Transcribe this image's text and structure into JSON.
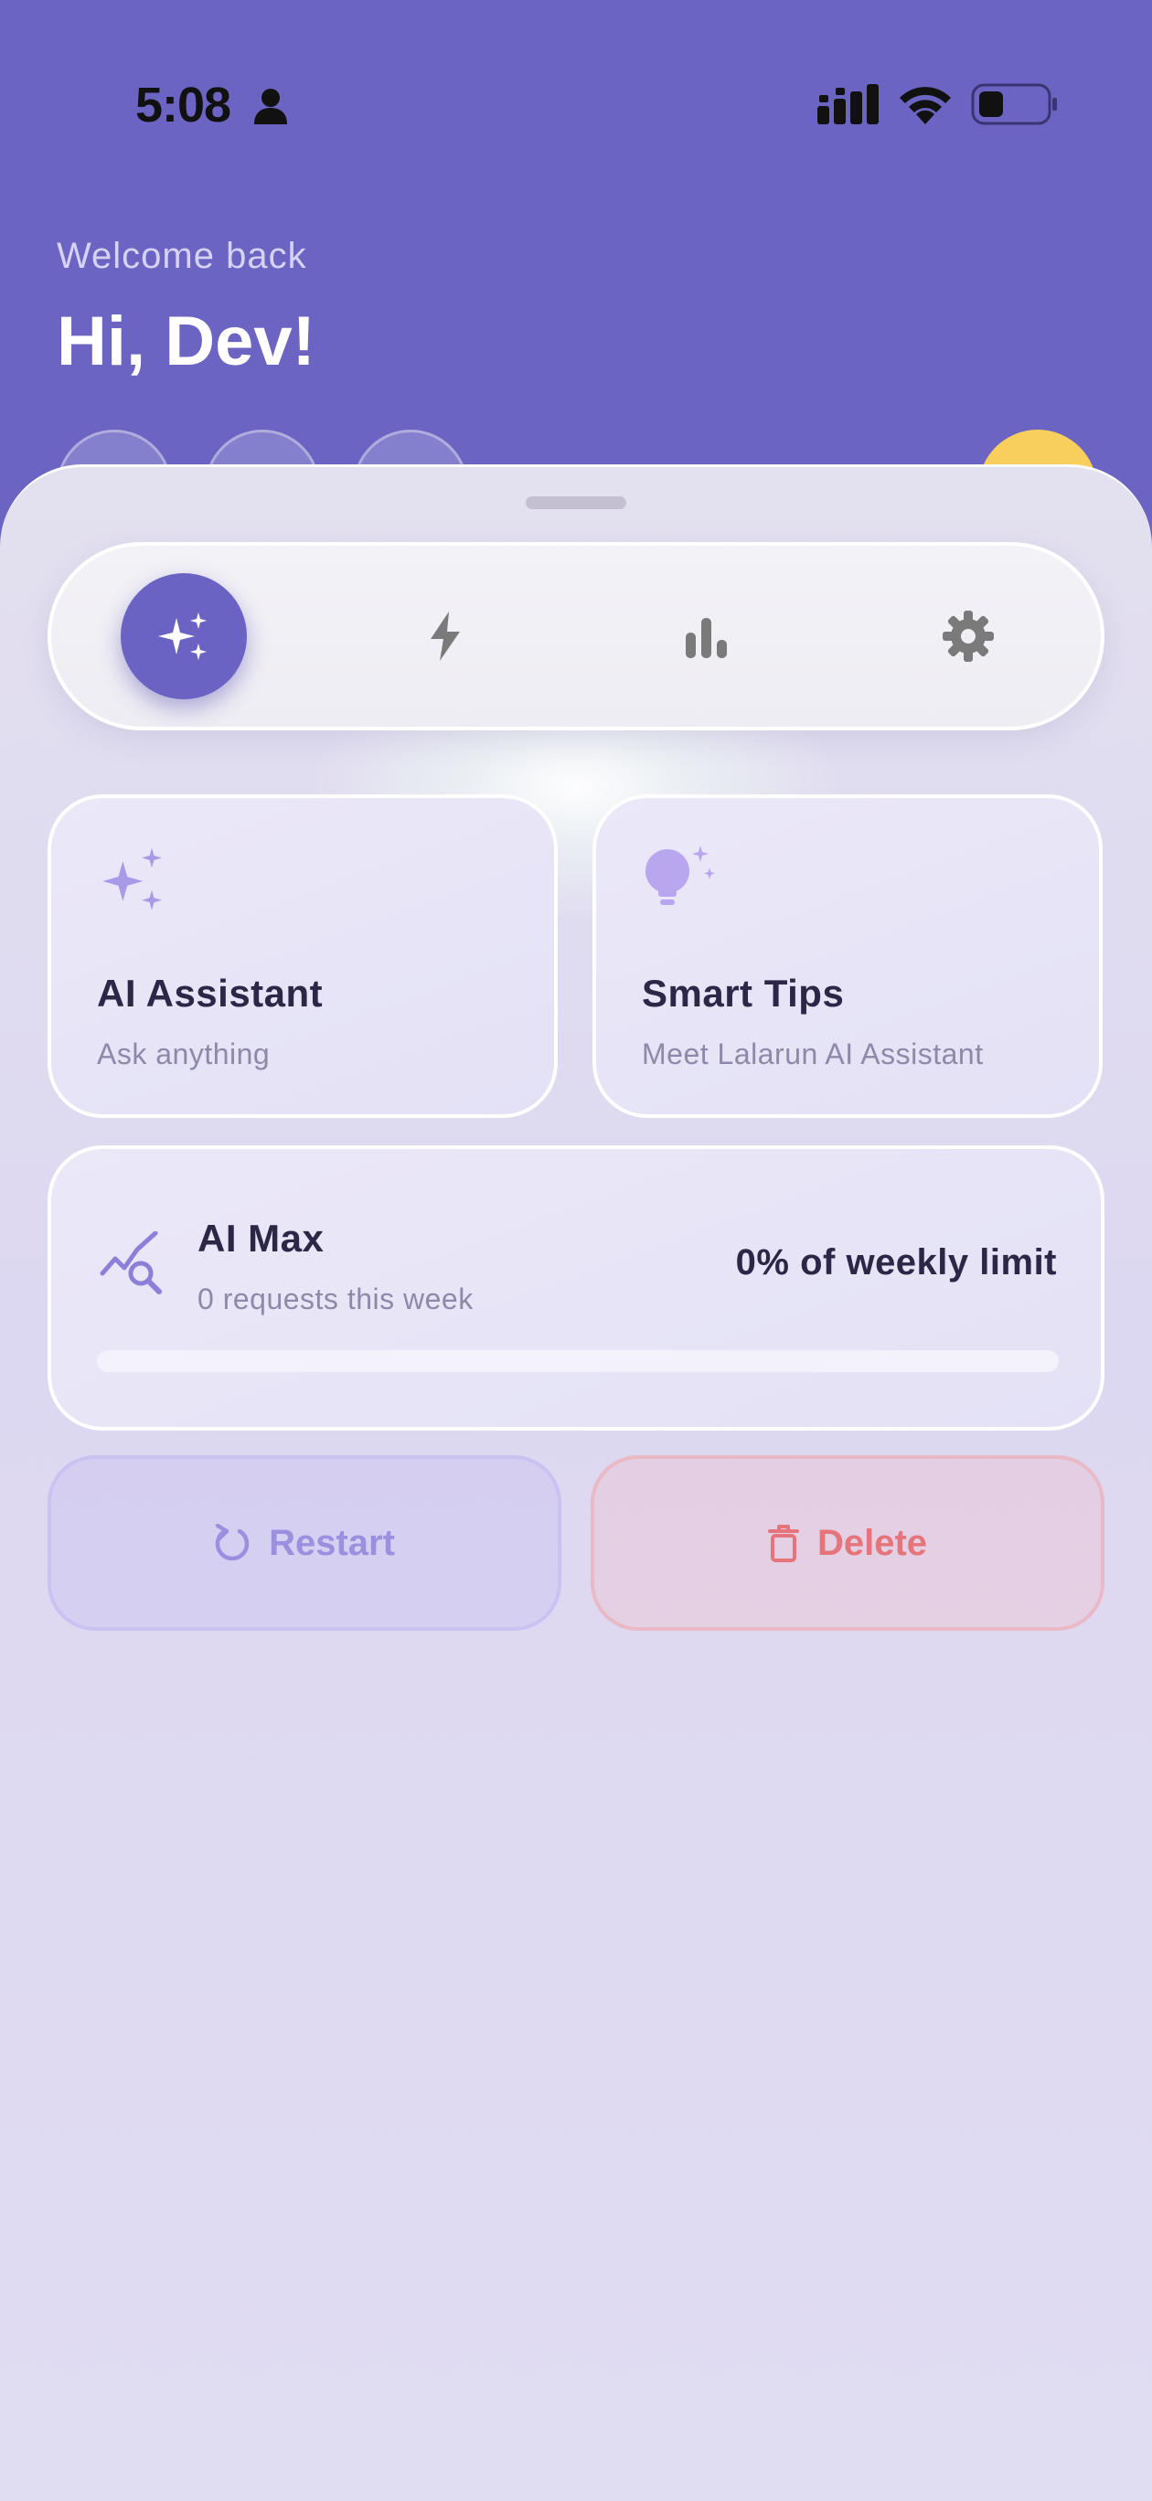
{
  "status_bar": {
    "time": "5:08"
  },
  "header": {
    "welcome": "Welcome back",
    "greeting": "Hi, Dev!"
  },
  "tabs": [
    {
      "name": "ai",
      "icon": "sparkles-icon",
      "active": true
    },
    {
      "name": "quick",
      "icon": "lightning-icon",
      "active": false
    },
    {
      "name": "stats",
      "icon": "bar-chart-icon",
      "active": false
    },
    {
      "name": "settings",
      "icon": "gear-icon",
      "active": false
    }
  ],
  "cards": {
    "ai_assistant": {
      "title": "AI Assistant",
      "subtitle": "Ask anything",
      "icon": "sparkles-icon"
    },
    "smart_tips": {
      "title": "Smart Tips",
      "subtitle": "Meet Lalarun AI Assistant",
      "icon": "lightbulb-icon"
    }
  },
  "usage": {
    "title": "AI Max",
    "subtitle": "0 requests this week",
    "limit_text": "0% of weekly limit",
    "progress_fraction": 0,
    "icon": "chart-search-icon"
  },
  "actions": {
    "restart_label": "Restart",
    "delete_label": "Delete"
  },
  "colors": {
    "header_bg": "#6b64c2",
    "accent": "#6b63c4",
    "restart_text": "#9b90e0",
    "delete_text": "#e5757a",
    "avatar": "#f8cf5c"
  }
}
